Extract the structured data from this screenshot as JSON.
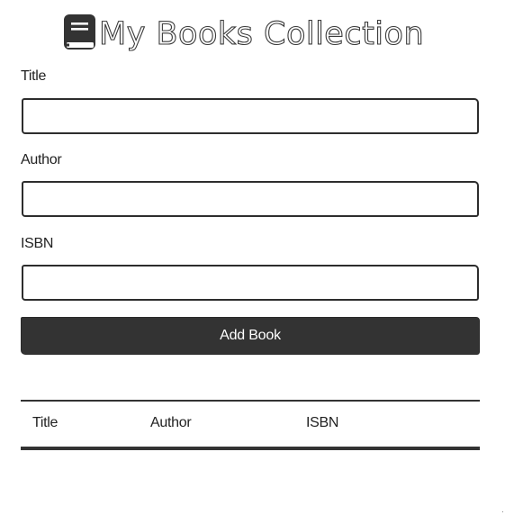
{
  "header": {
    "title": "My Books Collection",
    "icon": "book-icon"
  },
  "form": {
    "title_label": "Title",
    "title_value": "",
    "title_placeholder": "",
    "author_label": "Author",
    "author_value": "",
    "author_placeholder": "",
    "isbn_label": "ISBN",
    "isbn_value": "",
    "isbn_placeholder": "",
    "submit_label": "Add Book"
  },
  "table": {
    "columns": [
      "Title",
      "Author",
      "ISBN"
    ],
    "rows": []
  },
  "colors": {
    "primary": "#333333",
    "background": "#ffffff",
    "text": "#222222"
  }
}
